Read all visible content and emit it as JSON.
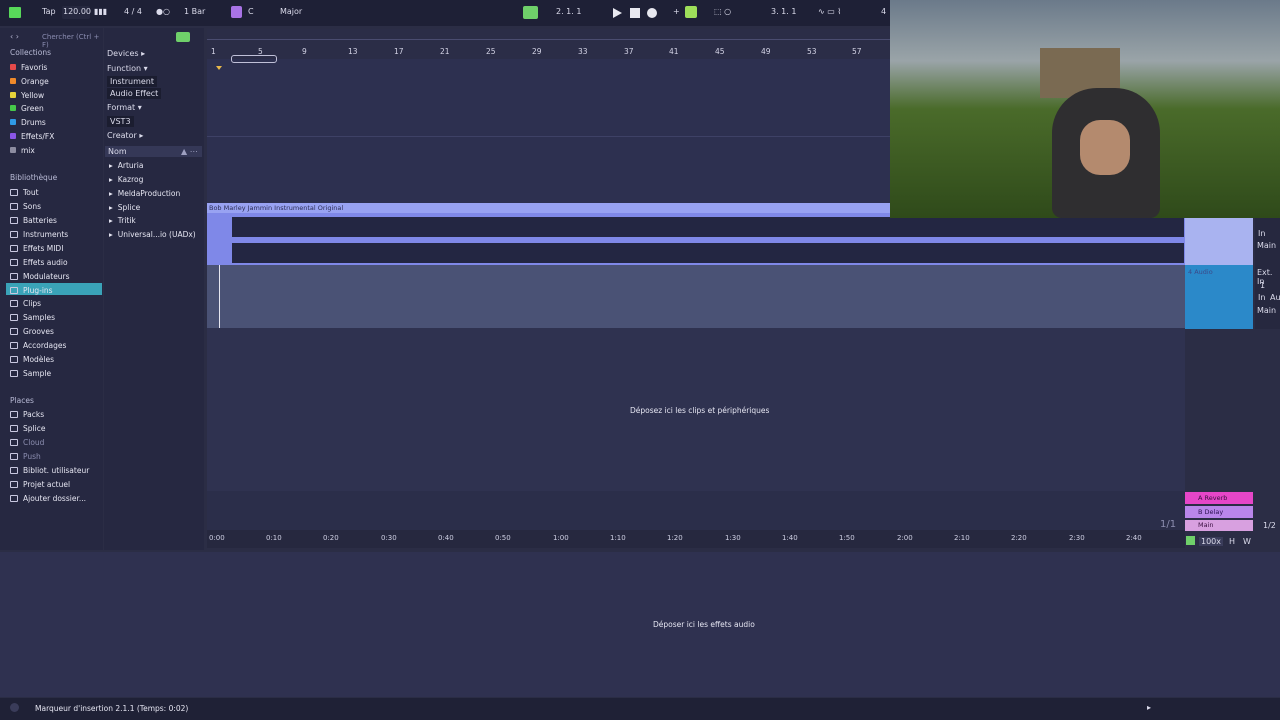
{
  "toolbar": {
    "tap": "Tap",
    "tempo": "120.00",
    "time_sig": "4 / 4",
    "quant": "1 Bar",
    "key": "C",
    "scale": "Major",
    "position": "2.   1.   1",
    "loop_start": "3.   1.   1",
    "right_num": "4"
  },
  "browser": {
    "search_placeholder": "Chercher (Ctrl + F)",
    "collections_title": "Collections",
    "collections": [
      {
        "label": "Favoris",
        "color": "#e64a4a"
      },
      {
        "label": "Orange",
        "color": "#f08a2a"
      },
      {
        "label": "Yellow",
        "color": "#e6d23a"
      },
      {
        "label": "Green",
        "color": "#46c84a"
      },
      {
        "label": "Drums",
        "color": "#2f9ae6"
      },
      {
        "label": "Effets/FX",
        "color": "#8a56e6"
      },
      {
        "label": "mix",
        "color": "#8c8ca0"
      }
    ],
    "library_title": "Bibliothèque",
    "library": [
      "Tout",
      "Sons",
      "Batteries",
      "Instruments",
      "Effets MIDI",
      "Effets audio",
      "Modulateurs",
      "Plug-ins",
      "Clips",
      "Samples",
      "Grooves",
      "Accordages",
      "Modèles",
      "Sample"
    ],
    "places_title": "Places",
    "places": [
      "Packs",
      "Splice",
      "Cloud",
      "Push",
      "Bibliot. utilisateur",
      "Projet actuel",
      "Ajouter dossier..."
    ],
    "filters": {
      "devices": "Devices",
      "function": "Function",
      "instrument": "Instrument",
      "audio_effect": "Audio Effect",
      "format": "Format",
      "vst3": "VST3",
      "creator": "Creator"
    },
    "list_header": "Nom",
    "list": [
      "Arturia",
      "Kazrog",
      "MeldaProduction",
      "Splice",
      "Tritik",
      "Universal...io (UADx)"
    ]
  },
  "arrangement": {
    "bars": [
      "1",
      "5",
      "9",
      "13",
      "17",
      "21",
      "25",
      "29",
      "33",
      "37",
      "41",
      "45",
      "49",
      "53",
      "57"
    ],
    "clip_name": "Bob Marley Jammin Instrumental Original",
    "drop_text": "Déposez ici les clips et périphériques",
    "times": [
      "0:00",
      "0:10",
      "0:20",
      "0:30",
      "0:40",
      "0:50",
      "1:00",
      "1:10",
      "1:20",
      "1:30",
      "1:40",
      "1:50",
      "2:00",
      "2:10",
      "2:20",
      "2:30",
      "2:40"
    ],
    "page": "1/1"
  },
  "mixer": {
    "track_name": "4 Audio",
    "in": "In",
    "main": "Main",
    "ext_in": "Ext. In",
    "one": "1",
    "au": "Au",
    "returns": [
      {
        "label": "A Reverb",
        "color": "#e646c8"
      },
      {
        "label": "B Delay",
        "color": "#b986ea"
      },
      {
        "label": "Main",
        "color": "#d8a0e0"
      }
    ],
    "ratio": "1/2",
    "zoom": "100x",
    "h": "H",
    "w": "W"
  },
  "device_area": {
    "drop_text": "Déposer ici les effets audio"
  },
  "status": {
    "text": "Marqueur d'insertion 2.1.1 (Temps: 0:02)"
  }
}
